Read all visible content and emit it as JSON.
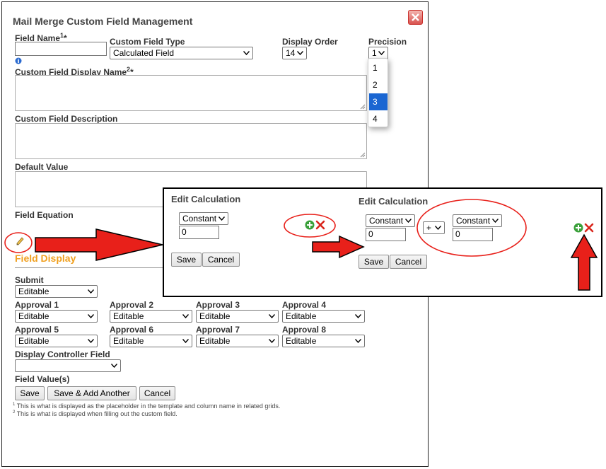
{
  "dialog": {
    "title": "Mail Merge Custom Field Management",
    "fields": {
      "field_name": {
        "label": "Field Name",
        "sup": "1",
        "req": "*",
        "value": ""
      },
      "custom_field_type": {
        "label": "Custom Field Type",
        "value": "Calculated Field"
      },
      "display_order": {
        "label": "Display Order",
        "value": "14"
      },
      "precision": {
        "label": "Precision",
        "value": "1",
        "options": [
          "1",
          "2",
          "3",
          "4"
        ],
        "highlighted": "3"
      },
      "display_name": {
        "label": "Custom Field Display Name",
        "sup": "2",
        "req": "*"
      },
      "description": {
        "label": "Custom Field Description"
      },
      "default_value": {
        "label": "Default Value"
      },
      "equation": {
        "label": "Field Equation"
      }
    },
    "field_display": {
      "heading": "Field Display",
      "submit": {
        "label": "Submit",
        "value": "Editable"
      },
      "approvals": [
        {
          "label": "Approval 1",
          "value": "Editable"
        },
        {
          "label": "Approval 2",
          "value": "Editable"
        },
        {
          "label": "Approval 3",
          "value": "Editable"
        },
        {
          "label": "Approval 4",
          "value": "Editable"
        },
        {
          "label": "Approval 5",
          "value": "Editable"
        },
        {
          "label": "Approval 6",
          "value": "Editable"
        },
        {
          "label": "Approval 7",
          "value": "Editable"
        },
        {
          "label": "Approval 8",
          "value": "Editable"
        }
      ],
      "controller": {
        "label": "Display Controller Field",
        "value": ""
      },
      "field_values": {
        "label": "Field Value(s)"
      }
    },
    "buttons": {
      "save": "Save",
      "save_add": "Save & Add Another",
      "cancel": "Cancel"
    },
    "footnotes": [
      {
        "num": "1",
        "text": "This is what is displayed as the placeholder in the template and column name in related grids."
      },
      {
        "num": "2",
        "text": "This is what is displayed when filling out the custom field."
      }
    ]
  },
  "edit_calc": {
    "left": {
      "title": "Edit Calculation",
      "type": "Constant",
      "value": "0",
      "save": "Save",
      "cancel": "Cancel"
    },
    "right": {
      "title": "Edit Calculation",
      "type1": "Constant",
      "value1": "0",
      "operator": "+",
      "type2": "Constant",
      "value2": "0",
      "save": "Save",
      "cancel": "Cancel"
    }
  },
  "colors": {
    "annotation_red": "#e8201a",
    "section_orange": "#f0a020",
    "add_green": "#3aa03a",
    "remove_red": "#d9261c",
    "highlight_blue": "#1a66d2"
  }
}
